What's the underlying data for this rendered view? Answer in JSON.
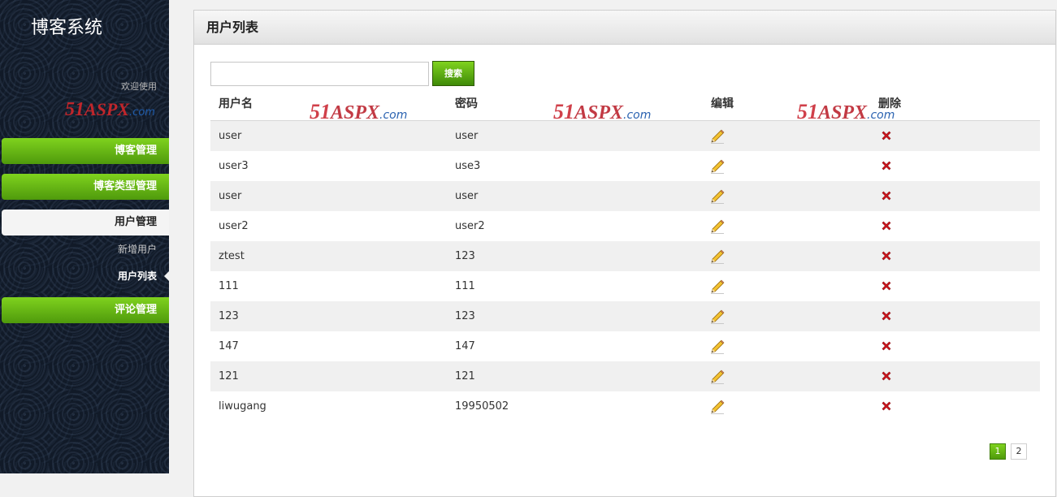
{
  "sidebar": {
    "title": "博客系统",
    "welcome": "欢迎使用",
    "logo": {
      "num": "51",
      "brand": "ASPX",
      "tld": ".com"
    },
    "menu": {
      "blog_manage": "博客管理",
      "blog_type_manage": "博客类型管理",
      "user_manage": "用户管理",
      "add_user": "新增用户",
      "user_list": "用户列表",
      "comment_manage": "评论管理"
    }
  },
  "main": {
    "header": "用户列表",
    "search": {
      "value": "",
      "placeholder": "",
      "button": "搜索"
    },
    "watermark": {
      "num": "51",
      "brand": "ASPX",
      "tld": ".com"
    },
    "table": {
      "columns": [
        "用户名",
        "密码",
        "编辑",
        "删除"
      ],
      "rows": [
        {
          "username": "user",
          "password": "user"
        },
        {
          "username": "user3",
          "password": "use3"
        },
        {
          "username": "user",
          "password": "user"
        },
        {
          "username": "user2",
          "password": "user2"
        },
        {
          "username": "ztest",
          "password": "123"
        },
        {
          "username": "111",
          "password": "111"
        },
        {
          "username": "123",
          "password": "123"
        },
        {
          "username": "147",
          "password": "147"
        },
        {
          "username": "121",
          "password": "121"
        },
        {
          "username": "liwugang",
          "password": "19950502"
        }
      ]
    },
    "pagination": {
      "pages": [
        "1",
        "2"
      ],
      "current": "1"
    }
  },
  "icons": {
    "edit": "pencil-icon",
    "delete": "red-x-icon"
  },
  "colors": {
    "accent": "#5ea91a",
    "sidebar_bg": "#111a28",
    "delete": "#c8161d"
  }
}
